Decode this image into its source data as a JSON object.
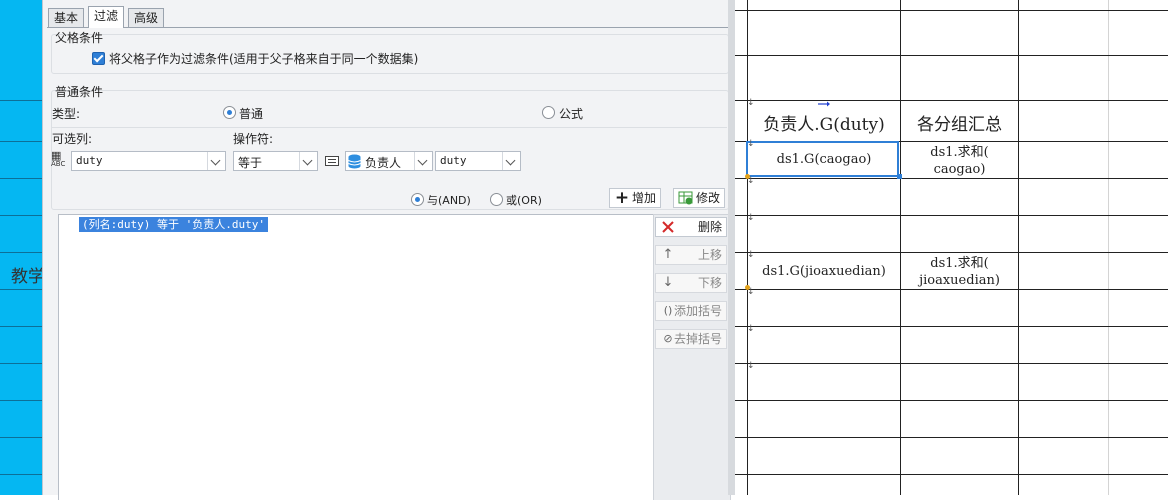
{
  "dialog": {
    "tabs": [
      {
        "label": "基本",
        "active": false
      },
      {
        "label": "过滤",
        "active": true
      },
      {
        "label": "高级",
        "active": false
      }
    ],
    "parent_condition": {
      "group_label": "父格条件",
      "checkbox_label": "将父格子作为过滤条件(适用于父子格来自于同一个数据集)",
      "checked": true
    },
    "normal_condition": {
      "group_label": "普通条件",
      "type_label": "类型:",
      "type_options": [
        {
          "label": "普通",
          "selected": true
        },
        {
          "label": "公式",
          "selected": false
        }
      ],
      "column_label": "可选列:",
      "column_value": "duty",
      "operator_label": "操作符:",
      "operator_value": "等于",
      "dataset_value": "负责人",
      "field_value": "duty",
      "logic_options": [
        {
          "label": "与(AND)",
          "selected": true
        },
        {
          "label": "或(OR)",
          "selected": false
        }
      ],
      "add_button": "增加",
      "modify_button": "修改"
    },
    "conditions": [
      "(列名:duty) 等于 '负责人.duty'"
    ],
    "side_buttons": {
      "delete": "删除",
      "move_up": "上移",
      "move_down": "下移",
      "add_bracket": "添加括号",
      "remove_bracket": "去掉括号"
    }
  },
  "sheet": {
    "left_fragment": "教学",
    "header_cells": {
      "c1": "负责人.G(duty)",
      "c2": "各分组汇总"
    },
    "row1": {
      "c1": "ds1.G(caogao)",
      "c2_line1": "ds1.求和(",
      "c2_line2": "caogao)"
    },
    "row2": {
      "c1": "ds1.G(jioaxuedian)",
      "c2_line1": "ds1.求和(",
      "c2_line2": "jioaxuedian)"
    },
    "colors": {
      "left_strip": "#05b7f2",
      "selection": "#2f7fd6",
      "accent": "#3b83de"
    }
  }
}
